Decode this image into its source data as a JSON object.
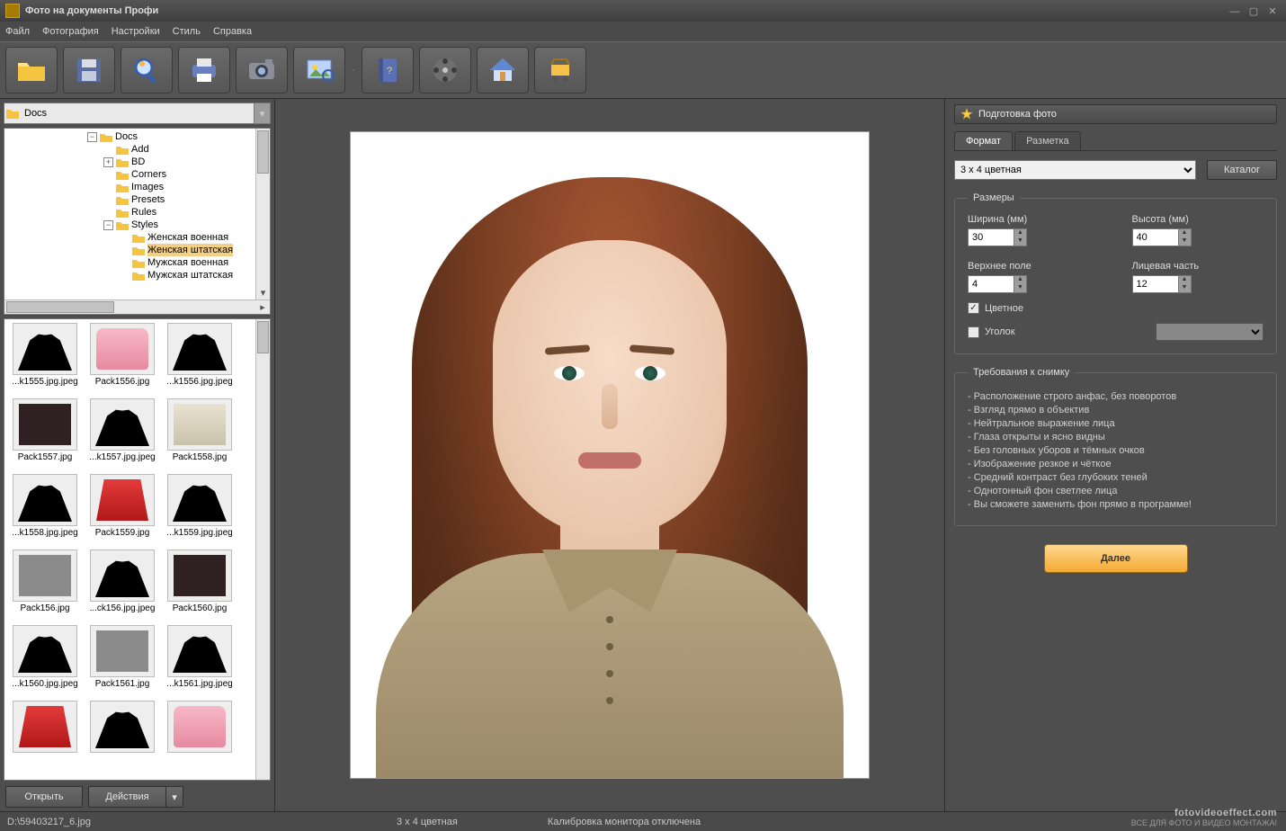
{
  "app": {
    "title": "Фото на документы Профи"
  },
  "menu": [
    "Файл",
    "Фотография",
    "Настройки",
    "Стиль",
    "Справка"
  ],
  "toolbar": [
    {
      "name": "open-folder-icon"
    },
    {
      "name": "save-icon"
    },
    {
      "name": "zoom-icon"
    },
    {
      "name": "print-icon"
    },
    {
      "name": "camera-icon"
    },
    {
      "name": "image-adjust-icon"
    },
    {
      "name": "help-book-icon"
    },
    {
      "name": "film-reel-icon"
    },
    {
      "name": "home-icon"
    },
    {
      "name": "cart-icon"
    }
  ],
  "path": "Docs",
  "tree": {
    "root": "Docs",
    "children": [
      "Add",
      "BD",
      "Corners",
      "Images",
      "Presets",
      "Rules",
      "Styles"
    ],
    "styles_children": [
      "Женская военная",
      "Женская штатская",
      "Мужская военная",
      "Мужская штатская"
    ],
    "selected": "Женская штатская"
  },
  "thumbnails": [
    "...k1555.jpg.jpeg",
    "Pack1556.jpg",
    "...k1556.jpg.jpeg",
    "Pack1557.jpg",
    "...k1557.jpg.jpeg",
    "Pack1558.jpg",
    "...k1558.jpg.jpeg",
    "Pack1559.jpg",
    "...k1559.jpg.jpeg",
    "Pack156.jpg",
    "...ck156.jpg.jpeg",
    "Pack1560.jpg",
    "...k1560.jpg.jpeg",
    "Pack1561.jpg",
    "...k1561.jpg.jpeg",
    "",
    "",
    ""
  ],
  "thumb_styles": [
    "silh",
    "pinkT",
    "silh",
    "darkT",
    "silh",
    "shirtT",
    "silh",
    "redT",
    "silh",
    "grayT",
    "silh",
    "darkT",
    "silh",
    "grayT",
    "silh",
    "redT",
    "silh",
    "pinkT"
  ],
  "left_buttons": {
    "open": "Открыть",
    "actions": "Действия"
  },
  "right": {
    "panel_title": "Подготовка фото",
    "tabs": [
      "Формат",
      "Разметка"
    ],
    "format_value": "3 x 4 цветная",
    "catalog_btn": "Каталог",
    "sizes_legend": "Размеры",
    "width_label": "Ширина (мм)",
    "height_label": "Высота (мм)",
    "top_label": "Верхнее поле",
    "face_label": "Лицевая часть",
    "width_val": "30",
    "height_val": "40",
    "top_val": "4",
    "face_val": "12",
    "color_chk": "Цветное",
    "corner_chk": "Уголок",
    "req_legend": "Требования к снимку",
    "requirements": [
      "Расположение строго анфас, без поворотов",
      "Взгляд прямо в объектив",
      "Нейтральное выражение лица",
      "Глаза открыты и ясно видны",
      "Без головных уборов и тёмных очков",
      "Изображение резкое и чёткое",
      "Средний контраст без глубоких теней",
      "Однотонный фон светлее лица",
      "Вы сможете заменить фон прямо в программе!"
    ],
    "next_btn": "Далее"
  },
  "status": {
    "file": "D:\\59403217_6.jpg",
    "format": "3 x 4 цветная",
    "calibration": "Калибровка монитора отключена"
  },
  "watermark": {
    "domain": "fotovideoeffect.com",
    "sub": "ВСЕ ДЛЯ ФОТО И ВИДЕО МОНТАЖА!"
  }
}
